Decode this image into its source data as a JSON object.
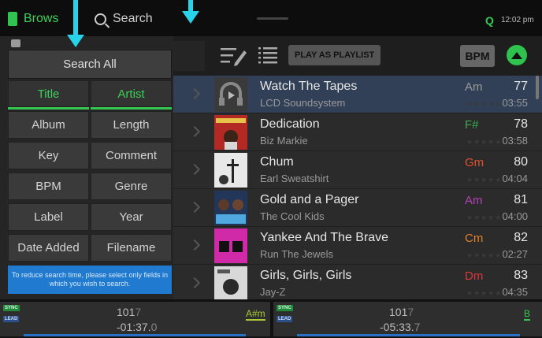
{
  "topbar": {
    "browse_label": "Brows",
    "search_label": "Search",
    "clock": "12:02 pm",
    "q_label": "Q"
  },
  "toolbar": {
    "play_as_playlist": "PLAY AS PLAYLIST",
    "bpm_button": "BPM"
  },
  "search_panel": {
    "search_all": "Search All",
    "fields": [
      {
        "label": "Title",
        "active": true
      },
      {
        "label": "Artist",
        "active": true
      },
      {
        "label": "Album",
        "active": false
      },
      {
        "label": "Length",
        "active": false
      },
      {
        "label": "Key",
        "active": false
      },
      {
        "label": "Comment",
        "active": false
      },
      {
        "label": "BPM",
        "active": false
      },
      {
        "label": "Genre",
        "active": false
      },
      {
        "label": "Label",
        "active": false
      },
      {
        "label": "Year",
        "active": false
      },
      {
        "label": "Date Added",
        "active": false
      },
      {
        "label": "Filename",
        "active": false
      }
    ],
    "notice": "To reduce search time, please select only fields in which you wish to search."
  },
  "tracks": [
    {
      "title": "Watch The Tapes",
      "artist": "LCD Soundsystem",
      "key": "Am",
      "key_color": "#9a9a9a",
      "bpm": "77",
      "duration": "03:55",
      "selected": true
    },
    {
      "title": "Dedication",
      "artist": "Biz Markie",
      "key": "F#",
      "key_color": "#3ea84f",
      "bpm": "78",
      "duration": "03:58",
      "selected": false
    },
    {
      "title": "Chum",
      "artist": "Earl Sweatshirt",
      "key": "Gm",
      "key_color": "#e0502c",
      "bpm": "80",
      "duration": "04:04",
      "selected": false
    },
    {
      "title": "Gold and a Pager",
      "artist": "The Cool Kids",
      "key": "Am",
      "key_color": "#b040b8",
      "bpm": "81",
      "duration": "04:00",
      "selected": false
    },
    {
      "title": "Yankee And The Brave",
      "artist": "Run The Jewels",
      "key": "Cm",
      "key_color": "#e07f26",
      "bpm": "82",
      "duration": "02:27",
      "selected": false
    },
    {
      "title": "Girls, Girls, Girls",
      "artist": "Jay-Z",
      "key": "Dm",
      "key_color": "#d93838",
      "bpm": "83",
      "duration": "04:35",
      "selected": false
    }
  ],
  "decks": [
    {
      "sync": "SYNC",
      "lead": "LEAD",
      "bpm_main": "101",
      "bpm_decimal": "7",
      "time_main": "-01:37.",
      "time_decimal": "0",
      "key": "A#m",
      "key_color": "#a8c83a"
    },
    {
      "sync": "SYNC",
      "lead": "LEAD",
      "bpm_main": "101",
      "bpm_decimal": "7",
      "time_main": "-05:33.",
      "time_decimal": "7",
      "key": "B",
      "key_color": "#36c752"
    }
  ],
  "colors": {
    "accent_green": "#36c752",
    "arrow_cyan": "#28d2e8",
    "selected_row": "#314057",
    "notice_blue": "#1f7ad0"
  }
}
